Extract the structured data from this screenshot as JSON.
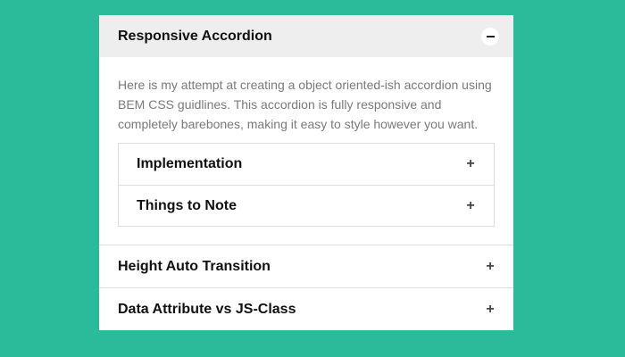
{
  "accordion": {
    "open_panel": {
      "title": "Responsive Accordion",
      "toggle": "minus-icon",
      "body_text": "Here is my attempt at creating a object oriented-ish accordion using BEM CSS guidlines. This accordion is fully responsive and completely barebones, making it easy to style however you want.",
      "nested": [
        {
          "title": "Implementation",
          "toggle": "+"
        },
        {
          "title": "Things to Note",
          "toggle": "+"
        }
      ]
    },
    "panels": [
      {
        "title": "Height Auto Transition",
        "toggle": "+"
      },
      {
        "title": "Data Attribute vs JS-Class",
        "toggle": "+"
      }
    ]
  },
  "colors": {
    "background": "#2bbb9b",
    "panel": "#ffffff",
    "active_header": "#eeeeee",
    "border": "#dddddd",
    "body_text": "#7a7a7a"
  }
}
